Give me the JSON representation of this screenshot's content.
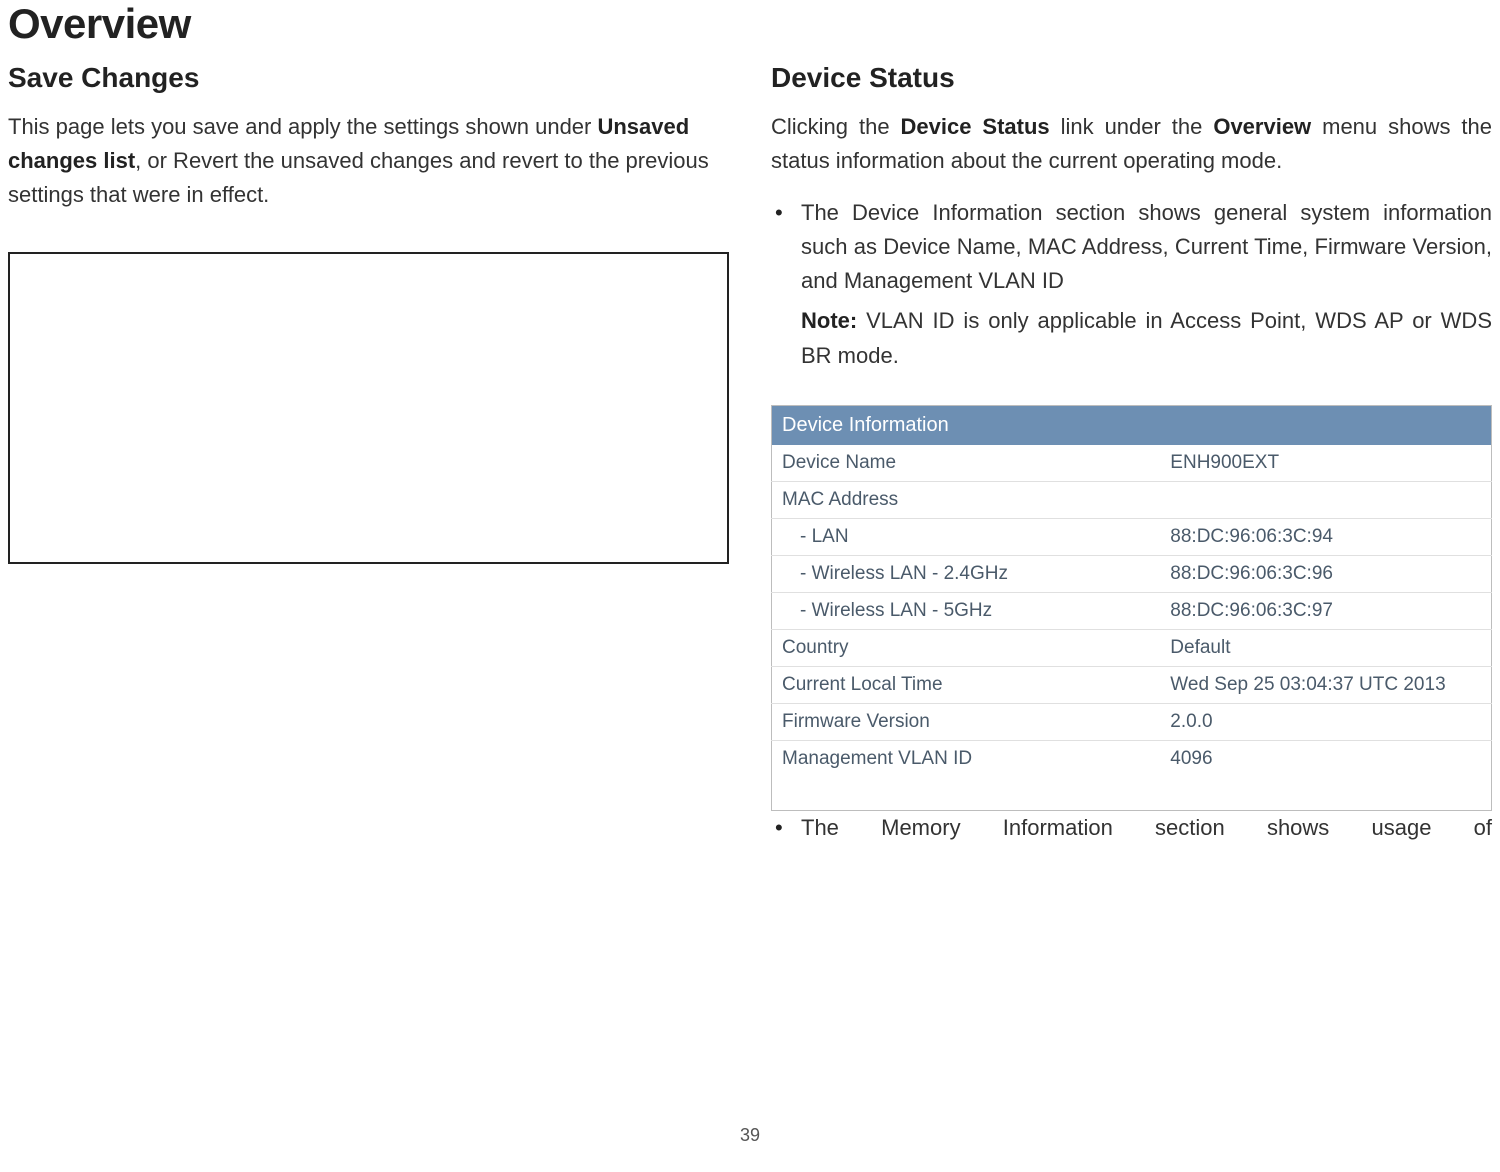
{
  "page": {
    "title": "Overview",
    "number": "39"
  },
  "left": {
    "heading": "Save Changes",
    "para_pre": "This page lets you save and apply the settings shown under ",
    "para_bold": "Unsaved changes list",
    "para_post": ", or Revert the unsaved changes and revert to the previous settings that were in effect."
  },
  "right": {
    "heading": "Device Status",
    "intro_pre": "Clicking the ",
    "intro_bold1": "Device Status",
    "intro_mid": " link under the ",
    "intro_bold2": "Overview",
    "intro_post": " menu shows the status information about the current operating mode.",
    "bullet1_pre": "The ",
    "bullet1_bold": "Device Information",
    "bullet1_post": " section shows general system information such as Device Name, MAC Address, Current Time, Firmware Version, and Management VLAN ID",
    "note_label": "Note:",
    "note_text": " VLAN ID is only applicable in Access Point, WDS AP or WDS BR mode.",
    "bullet2_pre": "The ",
    "bullet2_bold": "Memory Information",
    "bullet2_post": " section shows usage of"
  },
  "table": {
    "header": "Device Information",
    "rows": [
      {
        "label": "Device Name",
        "value": "ENH900EXT",
        "indent": false
      },
      {
        "label": "MAC Address",
        "value": "",
        "indent": false
      },
      {
        "label": "- LAN",
        "value": "88:DC:96:06:3C:94",
        "indent": true
      },
      {
        "label": "- Wireless LAN - 2.4GHz",
        "value": "88:DC:96:06:3C:96",
        "indent": true
      },
      {
        "label": "- Wireless LAN - 5GHz",
        "value": "88:DC:96:06:3C:97",
        "indent": true
      },
      {
        "label": "Country",
        "value": "Default",
        "indent": false
      },
      {
        "label": "Current Local Time",
        "value": "Wed Sep 25 03:04:37 UTC 2013",
        "indent": false
      },
      {
        "label": "Firmware Version",
        "value": "2.0.0",
        "indent": false
      },
      {
        "label": "Management VLAN ID",
        "value": "4096",
        "indent": false
      }
    ]
  }
}
